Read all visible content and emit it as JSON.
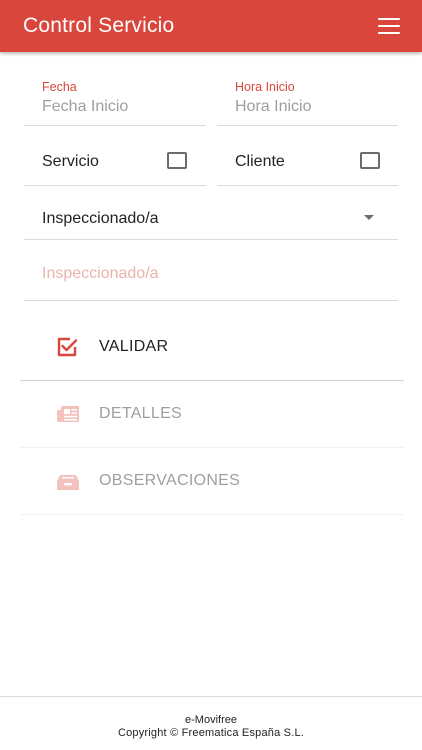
{
  "appbar": {
    "title": "Control Servicio",
    "menu_icon": "hamburger-menu-icon",
    "color": "#d9473c"
  },
  "form": {
    "fecha": {
      "label": "Fecha",
      "placeholder": "Fecha Inicio",
      "value": ""
    },
    "hora": {
      "label": "Hora Inicio",
      "placeholder": "Hora Inicio",
      "value": ""
    },
    "servicio": {
      "label": "Servicio",
      "checked": false
    },
    "cliente": {
      "label": "Cliente",
      "checked": false
    },
    "inspeccionado_select": {
      "selected": "Inspeccionado/a"
    },
    "inspeccionado_input": {
      "placeholder": "Inspeccionado/a",
      "value": ""
    }
  },
  "actions": [
    {
      "label": "VALIDAR",
      "icon": "checkbox-checked-icon",
      "enabled": true
    },
    {
      "label": "DETALLES",
      "icon": "newspaper-icon",
      "enabled": false
    },
    {
      "label": "OBSERVACIONES",
      "icon": "inbox-tray-icon",
      "enabled": false
    }
  ],
  "footer": {
    "line1": "e-Movifree",
    "line2": "Copyright © Freematica España S.L."
  }
}
